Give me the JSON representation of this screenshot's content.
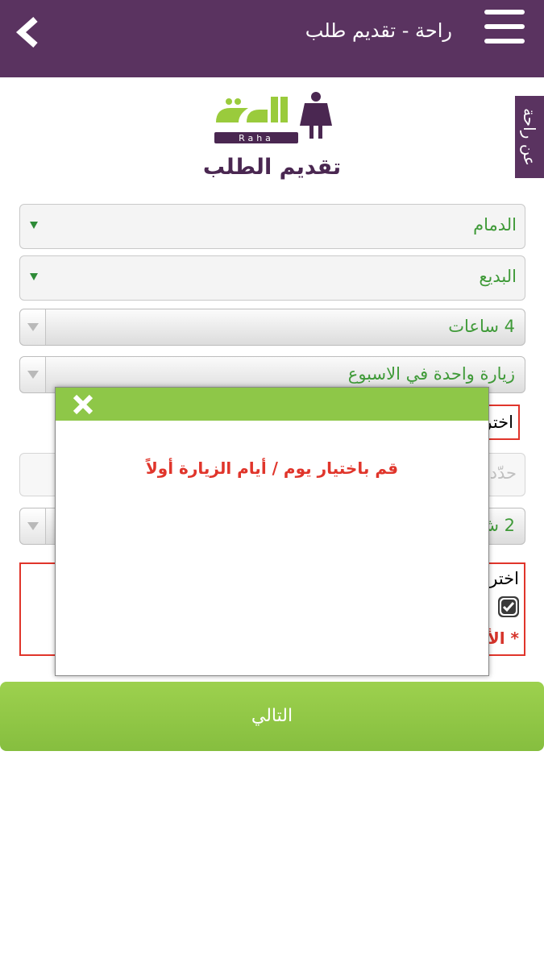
{
  "header": {
    "title": "راحة - تقديم طلب"
  },
  "side_tab": {
    "label": "عن راحة"
  },
  "logo": {
    "text_ar": "راحة",
    "text_en": "Raha"
  },
  "page": {
    "title": "تقديم الطلب"
  },
  "form": {
    "city": "الدمام",
    "district": "البديع",
    "hours": "4 ساعات",
    "visits": "زيارة واحدة في الاسبوع",
    "days_label_partial": "اختر",
    "date_placeholder_partial": "حدّد",
    "duration_partial": "2 ش",
    "terms_label_partial": "اختر",
    "required_partial": "* الأ"
  },
  "modal": {
    "message": "قم باختيار يوم / أيام الزيارة أولاً"
  },
  "next_button": {
    "label": "التالي"
  },
  "colors": {
    "primary": "#5a3360",
    "accent_green": "#8ec748",
    "error_red": "#e0352b"
  }
}
